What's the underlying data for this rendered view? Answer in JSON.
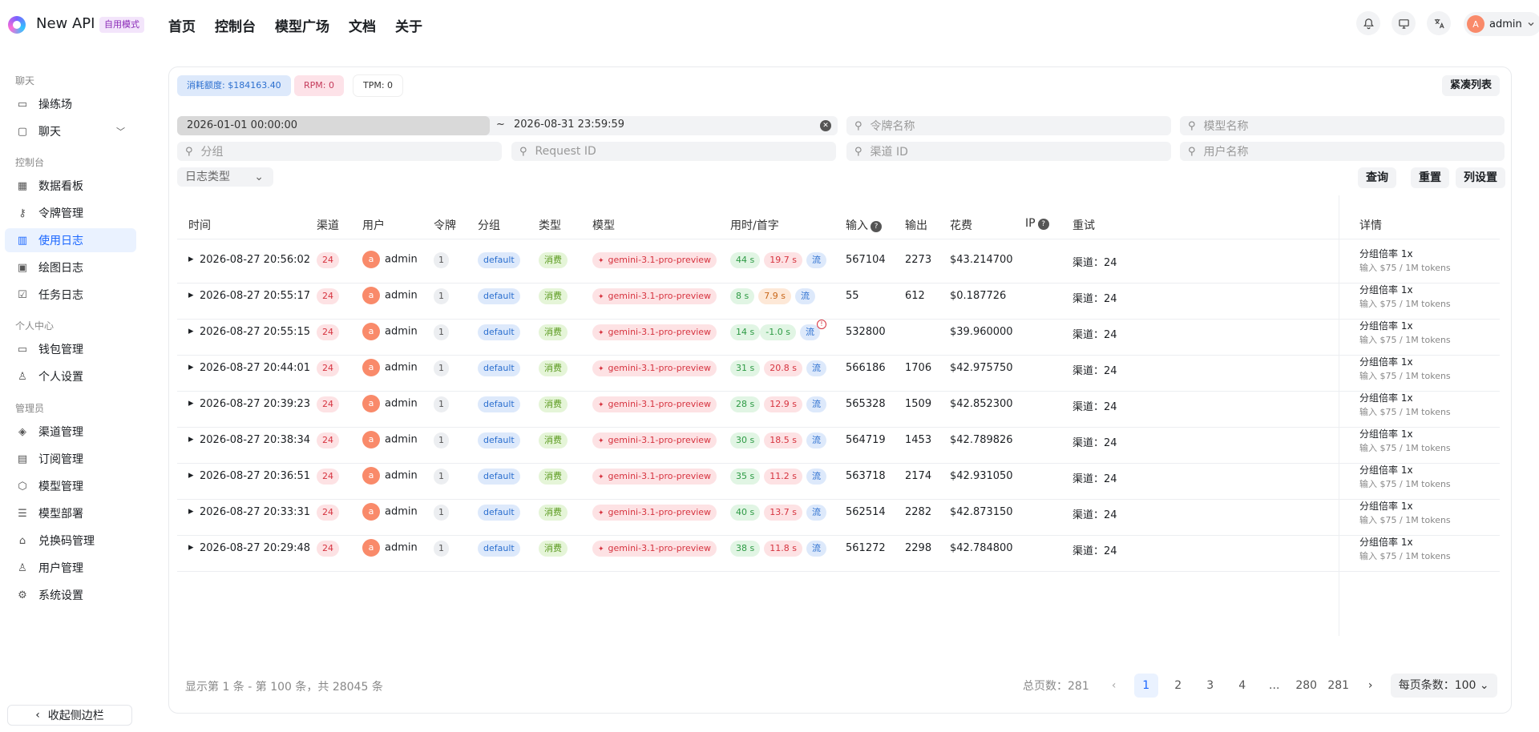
{
  "app": {
    "name": "New API",
    "mode_badge": "自用模式"
  },
  "topnav": [
    "首页",
    "控制台",
    "模型广场",
    "文档",
    "关于"
  ],
  "user": {
    "name": "admin",
    "initial": "A"
  },
  "sidebar": {
    "groups": [
      {
        "title": "聊天",
        "items": [
          {
            "label": "操练场",
            "icon": "grid-icon"
          },
          {
            "label": "聊天",
            "icon": "chat-icon"
          }
        ]
      },
      {
        "title": "控制台",
        "items": [
          {
            "label": "数据看板",
            "icon": "dashboard-icon"
          },
          {
            "label": "令牌管理",
            "icon": "key-icon"
          },
          {
            "label": "使用日志",
            "icon": "bar-chart-icon"
          },
          {
            "label": "绘图日志",
            "icon": "image-icon"
          },
          {
            "label": "任务日志",
            "icon": "check-icon"
          }
        ]
      },
      {
        "title": "个人中心",
        "items": [
          {
            "label": "钱包管理",
            "icon": "wallet-icon"
          },
          {
            "label": "个人设置",
            "icon": "user-icon"
          }
        ]
      },
      {
        "title": "管理员",
        "items": [
          {
            "label": "渠道管理",
            "icon": "layers-icon"
          },
          {
            "label": "订阅管理",
            "icon": "calendar-icon"
          },
          {
            "label": "模型管理",
            "icon": "cube-icon"
          },
          {
            "label": "模型部署",
            "icon": "server-icon"
          },
          {
            "label": "兑换码管理",
            "icon": "gift-icon"
          },
          {
            "label": "用户管理",
            "icon": "user-icon"
          },
          {
            "label": "系统设置",
            "icon": "gear-icon"
          }
        ]
      }
    ],
    "collapse_label": "收起侧边栏"
  },
  "stats": {
    "quota": "消耗额度: $184163.40",
    "rpm": "RPM: 0",
    "tpm": "TPM: 0"
  },
  "compact_label": "紧凑列表",
  "filters": {
    "date_start": "2026-01-01 00:00:00",
    "date_end": "2026-08-31 23:59:59",
    "token_placeholder": "令牌名称",
    "model_placeholder": "模型名称",
    "group_placeholder": "分组",
    "request_placeholder": "Request ID",
    "channel_placeholder": "渠道 ID",
    "user_placeholder": "用户名称",
    "log_type": "日志类型"
  },
  "actions": {
    "query": "查询",
    "reset": "重置",
    "columns": "列设置"
  },
  "table": {
    "headers": [
      "时间",
      "渠道",
      "用户",
      "令牌",
      "分组",
      "类型",
      "模型",
      "用时/首字",
      "输入",
      "输出",
      "花费",
      "IP",
      "重试",
      "详情"
    ],
    "rows": [
      {
        "time": "2026-08-27 20:56:02",
        "channel": "24",
        "user": "admin",
        "token": "1",
        "group": "default",
        "type": "消费",
        "model": "gemini-3.1-pro-preview",
        "dur": "44 s",
        "first": "19.7 s",
        "stream": "流",
        "input": "567104",
        "output": "2273",
        "cost": "$43.214700",
        "retry": "渠道：24",
        "d1": "分组倍率 1x",
        "d2": "输入 $75 / 1M tokens"
      },
      {
        "time": "2026-08-27 20:55:17",
        "channel": "24",
        "user": "admin",
        "token": "1",
        "group": "default",
        "type": "消费",
        "model": "gemini-3.1-pro-preview",
        "dur": "8 s",
        "first": "7.9 s",
        "stream": "流",
        "input": "55",
        "output": "612",
        "cost": "$0.187726",
        "retry": "渠道：24",
        "d1": "分组倍率 1x",
        "d2": "输入 $75 / 1M tokens"
      },
      {
        "time": "2026-08-27 20:55:15",
        "channel": "24",
        "user": "admin",
        "token": "1",
        "group": "default",
        "type": "消费",
        "model": "gemini-3.1-pro-preview",
        "dur": "14 s",
        "first": "-1.0 s",
        "stream": "流",
        "input": "532800",
        "output": "",
        "cost": "$39.960000",
        "retry": "渠道：24",
        "d1": "分组倍率 1x",
        "d2": "输入 $75 / 1M tokens"
      },
      {
        "time": "2026-08-27 20:44:01",
        "channel": "24",
        "user": "admin",
        "token": "1",
        "group": "default",
        "type": "消费",
        "model": "gemini-3.1-pro-preview",
        "dur": "31 s",
        "first": "20.8 s",
        "stream": "流",
        "input": "566186",
        "output": "1706",
        "cost": "$42.975750",
        "retry": "渠道：24",
        "d1": "分组倍率 1x",
        "d2": "输入 $75 / 1M tokens"
      },
      {
        "time": "2026-08-27 20:39:23",
        "channel": "24",
        "user": "admin",
        "token": "1",
        "group": "default",
        "type": "消费",
        "model": "gemini-3.1-pro-preview",
        "dur": "28 s",
        "first": "12.9 s",
        "stream": "流",
        "input": "565328",
        "output": "1509",
        "cost": "$42.852300",
        "retry": "渠道：24",
        "d1": "分组倍率 1x",
        "d2": "输入 $75 / 1M tokens"
      },
      {
        "time": "2026-08-27 20:38:34",
        "channel": "24",
        "user": "admin",
        "token": "1",
        "group": "default",
        "type": "消费",
        "model": "gemini-3.1-pro-preview",
        "dur": "30 s",
        "first": "18.5 s",
        "stream": "流",
        "input": "564719",
        "output": "1453",
        "cost": "$42.789826",
        "retry": "渠道：24",
        "d1": "分组倍率 1x",
        "d2": "输入 $75 / 1M tokens"
      },
      {
        "time": "2026-08-27 20:36:51",
        "channel": "24",
        "user": "admin",
        "token": "1",
        "group": "default",
        "type": "消费",
        "model": "gemini-3.1-pro-preview",
        "dur": "35 s",
        "first": "11.2 s",
        "stream": "流",
        "input": "563718",
        "output": "2174",
        "cost": "$42.931050",
        "retry": "渠道：24",
        "d1": "分组倍率 1x",
        "d2": "输入 $75 / 1M tokens"
      },
      {
        "time": "2026-08-27 20:33:31",
        "channel": "24",
        "user": "admin",
        "token": "1",
        "group": "default",
        "type": "消费",
        "model": "gemini-3.1-pro-preview",
        "dur": "40 s",
        "first": "13.7 s",
        "stream": "流",
        "input": "562514",
        "output": "2282",
        "cost": "$42.873150",
        "retry": "渠道：24",
        "d1": "分组倍率 1x",
        "d2": "输入 $75 / 1M tokens"
      },
      {
        "time": "2026-08-27 20:29:48",
        "channel": "24",
        "user": "admin",
        "token": "1",
        "group": "default",
        "type": "消费",
        "model": "gemini-3.1-pro-preview",
        "dur": "38 s",
        "first": "11.8 s",
        "stream": "流",
        "input": "561272",
        "output": "2298",
        "cost": "$42.784800",
        "retry": "渠道：24",
        "d1": "分组倍率 1x",
        "d2": "输入 $75 / 1M tokens"
      }
    ]
  },
  "pagination": {
    "info": "显示第 1 条 - 第 100 条，共 28045 条",
    "total_pages": "总页数：281",
    "pages": [
      "1",
      "2",
      "3",
      "4",
      "...",
      "280",
      "281"
    ],
    "page_size": "每页条数：100"
  }
}
